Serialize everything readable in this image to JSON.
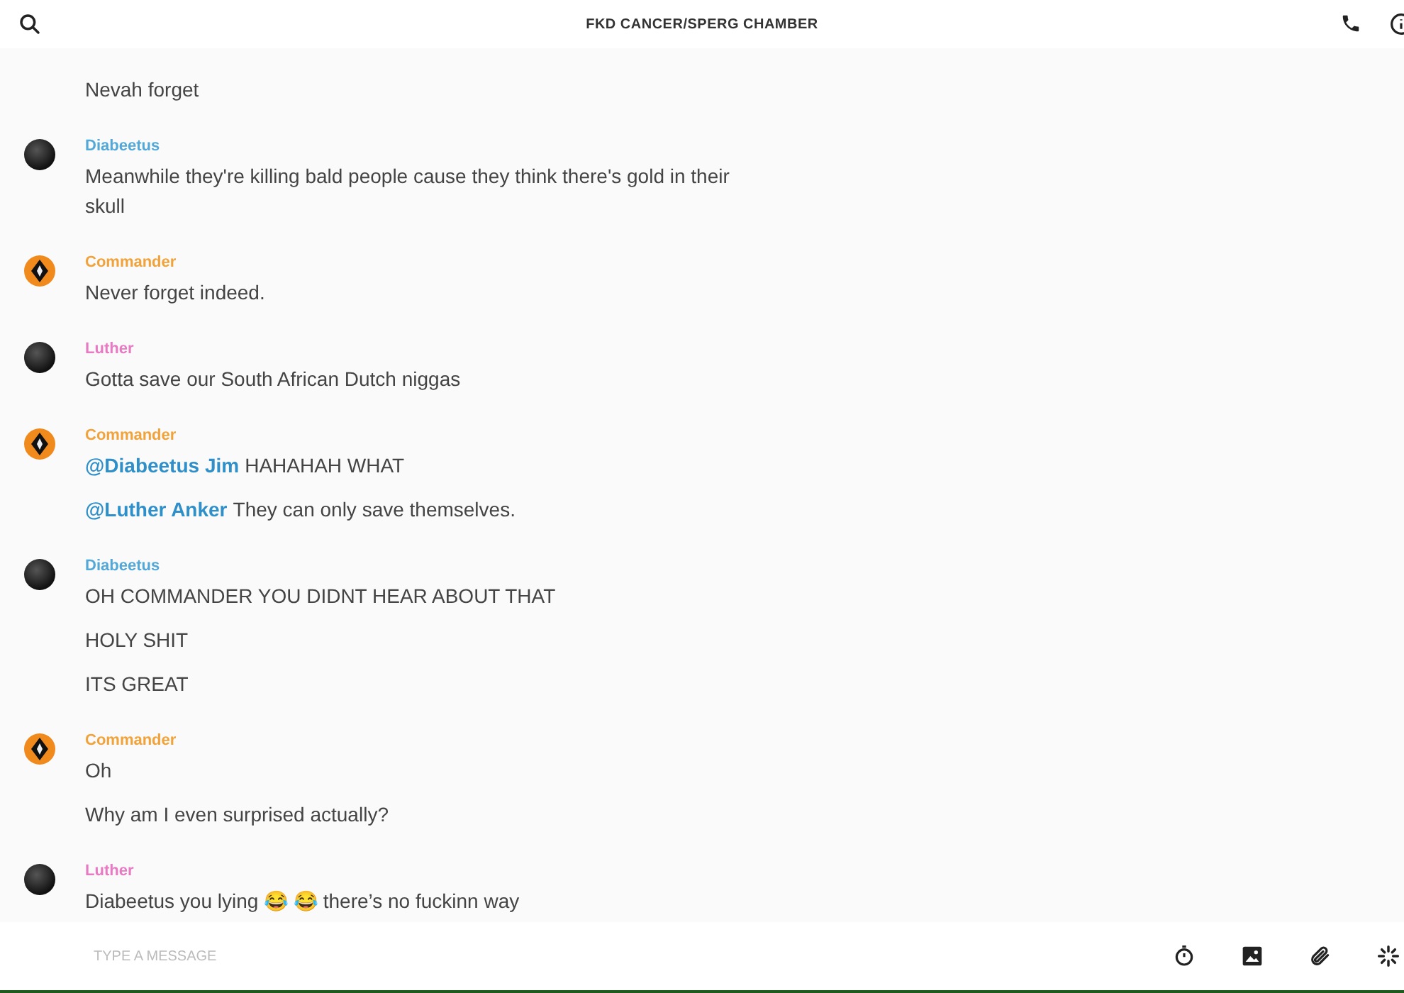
{
  "header": {
    "title": "FKD CANCER/SPERG CHAMBER"
  },
  "groups": [
    {
      "messages": [
        [
          {
            "kind": "text",
            "text": "Nevah forget"
          }
        ]
      ]
    },
    {
      "sender": "Diabeetus",
      "color": "#52a8d8",
      "kind": "dark",
      "messages": [
        [
          {
            "kind": "text",
            "text": "Meanwhile they're killing bald people cause they think there's gold in their skull"
          }
        ]
      ]
    },
    {
      "sender": "Commander",
      "color": "#f2a23a",
      "kind": "diamond",
      "messages": [
        [
          {
            "kind": "text",
            "text": "Never forget indeed."
          }
        ]
      ]
    },
    {
      "sender": "Luther",
      "color": "#e87ac4",
      "kind": "dark",
      "messages": [
        [
          {
            "kind": "text",
            "text": "Gotta save our South African Dutch niggas"
          }
        ]
      ]
    },
    {
      "sender": "Commander",
      "color": "#f2a23a",
      "kind": "diamond",
      "messages": [
        [
          {
            "kind": "mention",
            "text": "@Diabeetus Jim"
          },
          {
            "kind": "text",
            "text": "HAHAHAH WHAT"
          }
        ],
        [
          {
            "kind": "mention",
            "text": "@Luther Anker"
          },
          {
            "kind": "text",
            "text": "They can only save themselves."
          }
        ]
      ]
    },
    {
      "sender": "Diabeetus",
      "color": "#52a8d8",
      "kind": "dark",
      "messages": [
        [
          {
            "kind": "text",
            "text": "OH COMMANDER YOU DIDNT HEAR ABOUT THAT"
          }
        ],
        [
          {
            "kind": "text",
            "text": "HOLY SHIT"
          }
        ],
        [
          {
            "kind": "text",
            "text": "ITS GREAT"
          }
        ]
      ]
    },
    {
      "sender": "Commander",
      "color": "#f2a23a",
      "kind": "diamond",
      "messages": [
        [
          {
            "kind": "text",
            "text": "Oh"
          }
        ],
        [
          {
            "kind": "text",
            "text": "Why am I even surprised actually?"
          }
        ]
      ]
    },
    {
      "sender": "Luther",
      "color": "#e87ac4",
      "kind": "dark",
      "messages": [
        [
          {
            "kind": "text",
            "text": "Diabeetus you lying 😂 😂  there’s no fuckinn way"
          }
        ]
      ]
    }
  ],
  "composer": {
    "placeholder": "TYPE A MESSAGE"
  }
}
